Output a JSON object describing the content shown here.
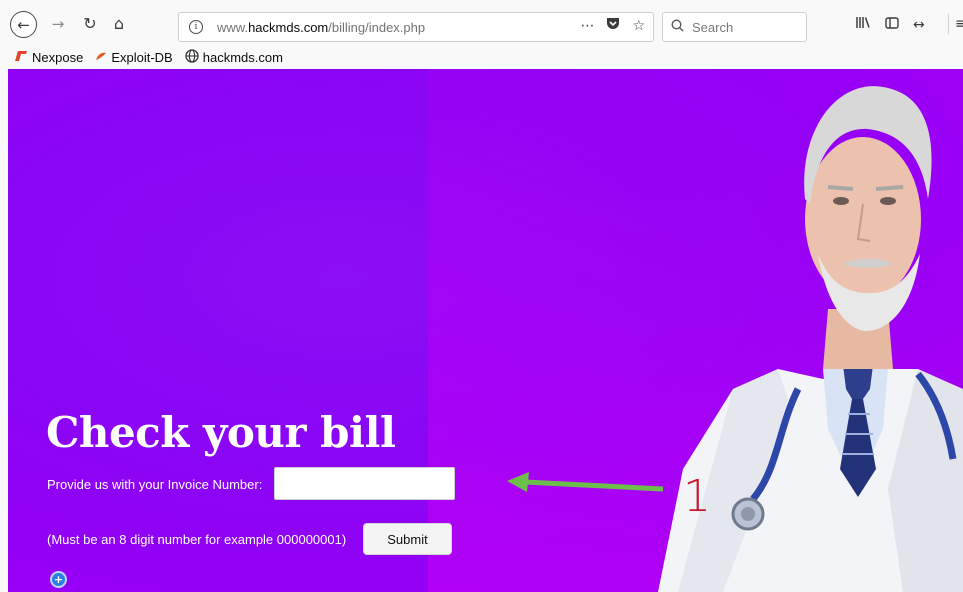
{
  "browser": {
    "url_prefix": "www.",
    "url_domain": "hackmds.com",
    "url_path": "/billing/index.php",
    "search_placeholder": "Search",
    "bookmarks": [
      {
        "label": "Nexpose",
        "icon": "nexpose-icon"
      },
      {
        "label": "Exploit-DB",
        "icon": "exploit-db-icon"
      },
      {
        "label": "hackmds.com",
        "icon": "globe-icon"
      }
    ]
  },
  "page": {
    "title": "Check your bill",
    "invoice_label": "Provide us with your Invoice Number:",
    "invoice_value": "",
    "hint": "(Must be an 8 digit number for example 000000001)",
    "submit_label": "Submit"
  },
  "annotation": {
    "number": "1",
    "arrow_color": "#6cc04a",
    "number_color": "#c8122a"
  },
  "colors": {
    "background_purple": "#8a06f5",
    "text_white": "#ffffff"
  }
}
